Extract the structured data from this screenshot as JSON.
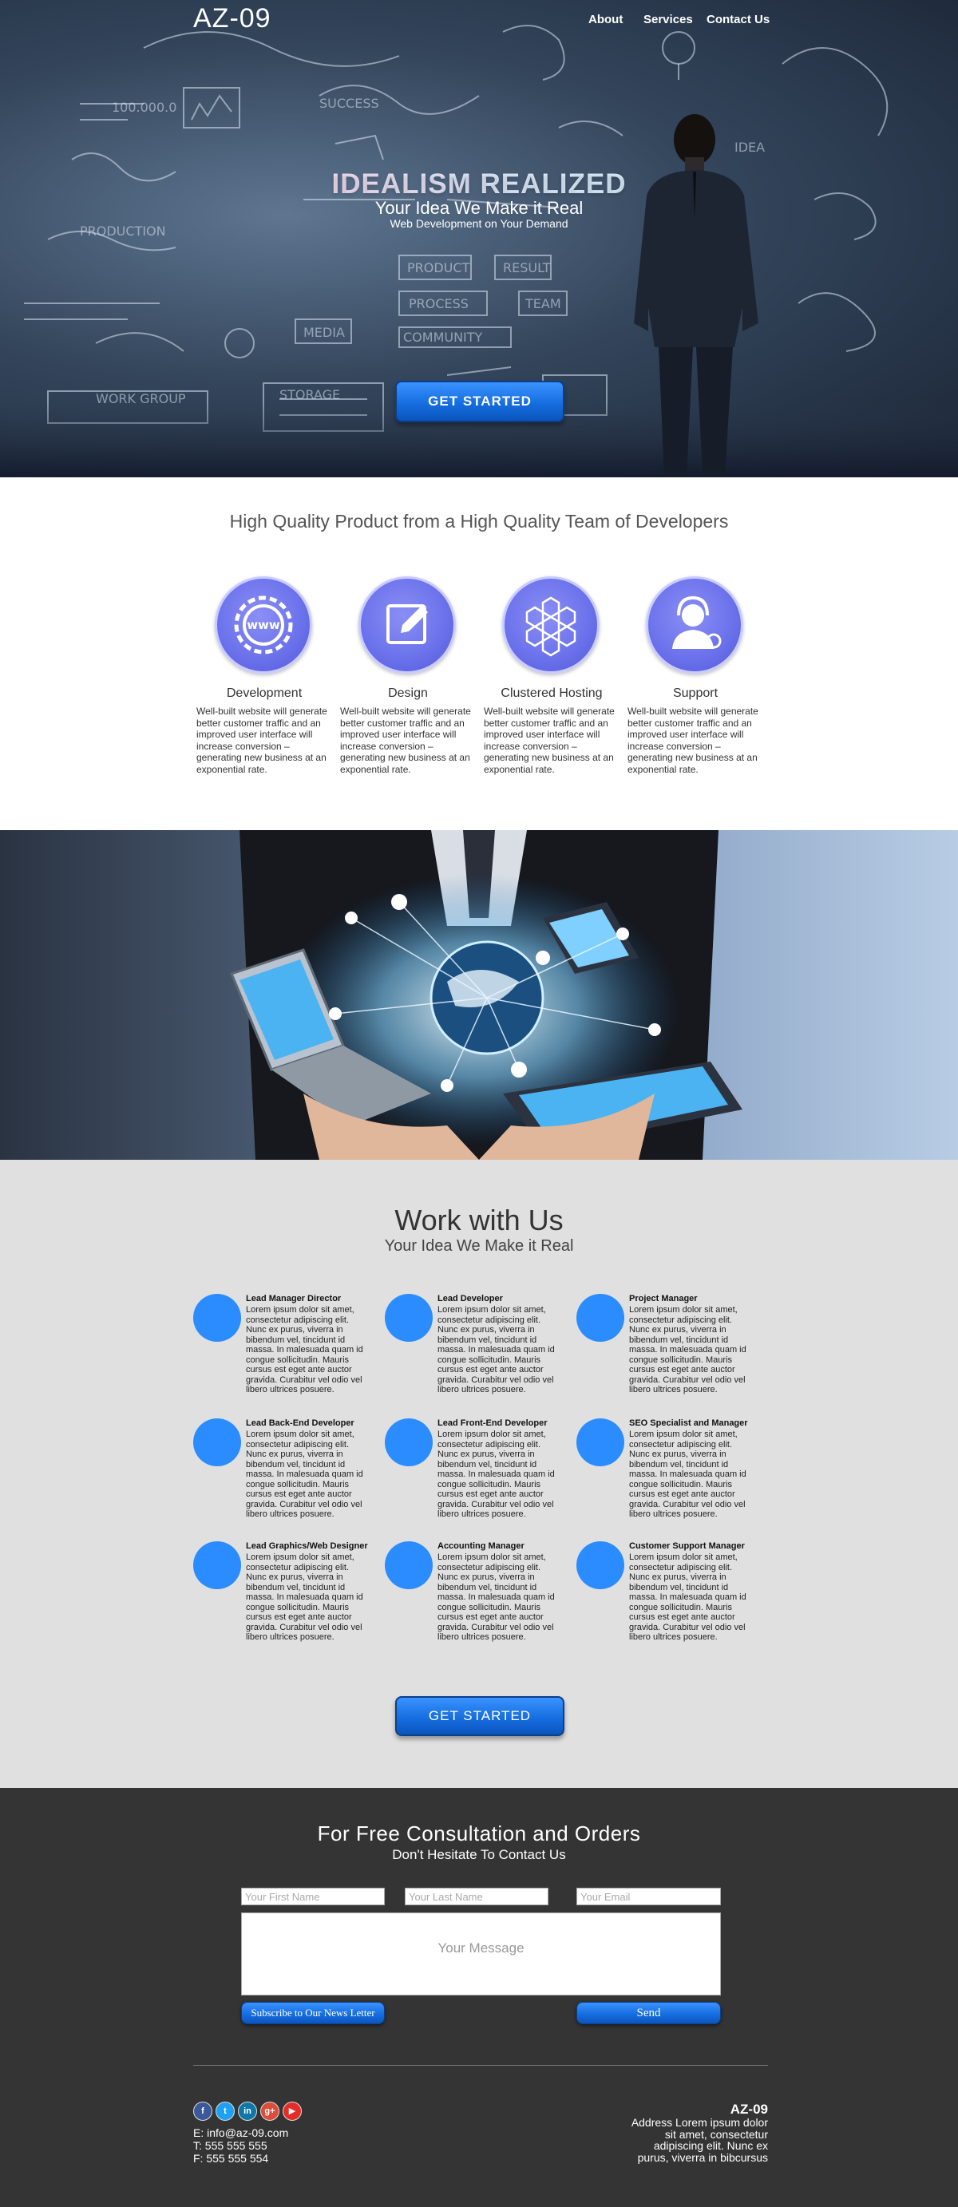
{
  "nav": {
    "logo": "AZ-09",
    "links": [
      "About",
      "Services",
      "Contact Us"
    ]
  },
  "hero": {
    "title": "IDEALISM REALIZED",
    "subtitle": "Your Idea We Make it Real",
    "tagline": "Web Development on Your Demand",
    "cta": "GET STARTED"
  },
  "quality": {
    "heading": "High Quality Product from a High Quality Team of Developers",
    "features": [
      {
        "title": "Development",
        "icon": "www-gear-icon",
        "text": "Well-built website will generate better customer traffic and an improved user interface will increase conversion – generating new business at an exponential rate."
      },
      {
        "title": "Design",
        "icon": "pencil-edit-icon",
        "text": "Well-built website will generate better customer traffic and an improved user interface will increase conversion – generating new business at an exponential rate."
      },
      {
        "title": "Clustered Hosting",
        "icon": "hexagon-cluster-icon",
        "text": "Well-built website will generate better customer traffic and an improved user interface will increase conversion – generating new business at an exponential rate."
      },
      {
        "title": "Support",
        "icon": "headset-support-icon",
        "text": "Well-built website will generate better customer traffic and an improved user interface will increase conversion – generating new business at an exponential rate."
      }
    ]
  },
  "work": {
    "title": "Work with Us",
    "subtitle": "Your Idea We Make it Real",
    "members": [
      {
        "title": "Lead Manager Director",
        "text": "Lorem ipsum dolor sit amet, consectetur adipiscing elit. Nunc ex purus, viverra in bibendum vel, tincidunt id massa. In malesuada quam id congue sollicitudin. Mauris cursus est eget ante auctor gravida. Curabitur vel odio vel libero ultrices posuere."
      },
      {
        "title": "Lead Developer",
        "text": "Lorem ipsum dolor sit amet, consectetur adipiscing elit. Nunc ex purus, viverra in bibendum vel, tincidunt id massa. In malesuada quam id congue sollicitudin. Mauris cursus est eget ante auctor gravida. Curabitur vel odio vel libero ultrices posuere."
      },
      {
        "title": "Project Manager",
        "text": "Lorem ipsum dolor sit amet, consectetur adipiscing elit. Nunc ex purus, viverra in bibendum vel, tincidunt id massa. In malesuada quam id congue sollicitudin. Mauris cursus est eget ante auctor gravida. Curabitur vel odio vel libero ultrices posuere."
      },
      {
        "title": "Lead Back-End Developer",
        "text": "Lorem ipsum dolor sit amet, consectetur adipiscing elit. Nunc ex purus, viverra in bibendum vel, tincidunt id massa. In malesuada quam id congue sollicitudin. Mauris cursus est eget ante auctor gravida. Curabitur vel odio vel libero ultrices posuere."
      },
      {
        "title": "Lead Front-End Developer",
        "text": "Lorem ipsum dolor sit amet, consectetur adipiscing elit. Nunc ex purus, viverra in bibendum vel, tincidunt id massa. In malesuada quam id congue sollicitudin. Mauris cursus est eget ante auctor gravida. Curabitur vel odio vel libero ultrices posuere."
      },
      {
        "title": "SEO Specialist and Manager",
        "text": "Lorem ipsum dolor sit amet, consectetur adipiscing elit. Nunc ex purus, viverra in bibendum vel, tincidunt id massa. In malesuada quam id congue sollicitudin. Mauris cursus est eget ante auctor gravida. Curabitur vel odio vel libero ultrices posuere."
      },
      {
        "title": "Lead Graphics/Web Designer",
        "text": "Lorem ipsum dolor sit amet, consectetur adipiscing elit. Nunc ex purus, viverra in bibendum vel, tincidunt id massa. In malesuada quam id congue sollicitudin. Mauris cursus est eget ante auctor gravida. Curabitur vel odio vel libero ultrices posuere."
      },
      {
        "title": "Accounting Manager",
        "text": "Lorem ipsum dolor sit amet, consectetur adipiscing elit. Nunc ex purus, viverra in bibendum vel, tincidunt id massa. In malesuada quam id congue sollicitudin. Mauris cursus est eget ante auctor gravida. Curabitur vel odio vel libero ultrices posuere."
      },
      {
        "title": "Customer Support Manager",
        "text": "Lorem ipsum dolor sit amet, consectetur adipiscing elit. Nunc ex purus, viverra in bibendum vel, tincidunt id massa. In malesuada quam id congue sollicitudin. Mauris cursus est eget ante auctor gravida. Curabitur vel odio vel libero ultrices posuere."
      }
    ],
    "cta": "GET STARTED"
  },
  "contact": {
    "title": "For Free Consultation and Orders",
    "subtitle": "Don't Hesitate To Contact Us",
    "first_name_placeholder": "Your First Name",
    "last_name_placeholder": "Your Last Name",
    "email_placeholder": "Your Email",
    "message_placeholder": "Your Message",
    "newsletter_label": "Subscribe to Our News Letter",
    "send_label": "Send"
  },
  "footer": {
    "social": [
      {
        "name": "facebook-icon",
        "glyph": "f",
        "color": "#3b5998"
      },
      {
        "name": "twitter-icon",
        "glyph": "t",
        "color": "#1da1f2"
      },
      {
        "name": "linkedin-icon",
        "glyph": "in",
        "color": "#0e76a8"
      },
      {
        "name": "google-plus-icon",
        "glyph": "g+",
        "color": "#dd4b39"
      },
      {
        "name": "youtube-icon",
        "glyph": "▶",
        "color": "#e52d27"
      }
    ],
    "email": "E: info@az-09.com",
    "phone": "T: 555 555 555",
    "fax": "F: 555 555 554",
    "brand": "AZ-09",
    "address": "Address Lorem ipsum dolor sit amet, consectetur adipiscing elit. Nunc ex purus, viverra in bibcursus"
  }
}
